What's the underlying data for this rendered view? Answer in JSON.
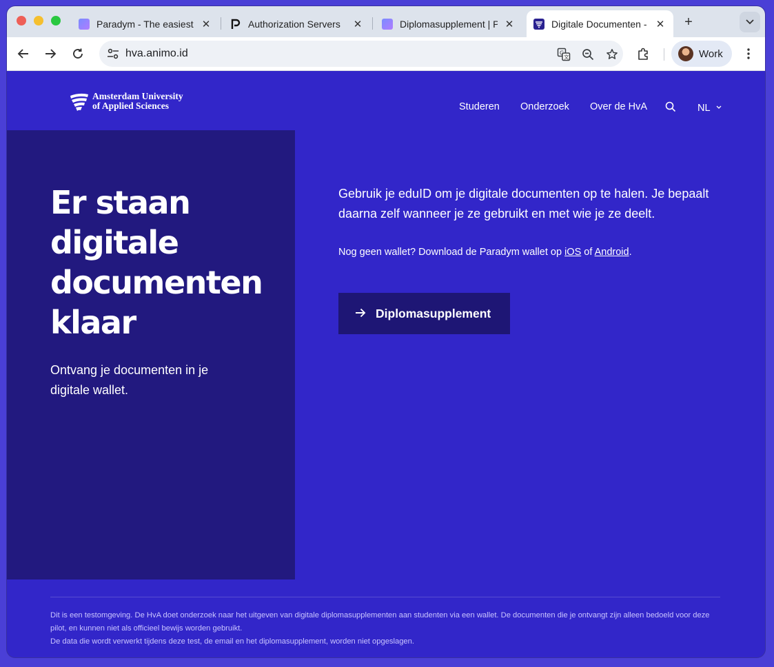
{
  "browser": {
    "tabs": [
      {
        "title": "Paradym - The easiest",
        "favicon": "paradym-gradient-icon",
        "active": false
      },
      {
        "title": "Authorization Servers",
        "favicon": "paradym-p-icon",
        "active": false
      },
      {
        "title": "Diplomasupplement | P",
        "favicon": "paradym-gradient-icon",
        "active": false
      },
      {
        "title": "Digitale Documenten -",
        "favicon": "hva-icon",
        "active": true
      }
    ],
    "url": "hva.animo.id",
    "profile_label": "Work"
  },
  "site": {
    "logo_line1": "Amsterdam University",
    "logo_line2": "of Applied Sciences",
    "nav": [
      "Studeren",
      "Onderzoek",
      "Over de HvA"
    ],
    "language": "NL"
  },
  "hero": {
    "title": "Er staan digitale documenten klaar",
    "subtitle": "Ontvang je documenten in je digitale wallet."
  },
  "main": {
    "intro": "Gebruik je eduID om je digitale documenten op te halen. Je bepaalt daarna zelf wanneer je ze gebruikt en met wie je ze deelt.",
    "wallet_prefix": "Nog geen wallet? Download de Paradym wallet op ",
    "wallet_ios": "iOS",
    "wallet_of": " of ",
    "wallet_android": "Android",
    "wallet_suffix": ".",
    "cta_label": "Diplomasupplement"
  },
  "footer": {
    "line1": "Dit is een testomgeving. De HvA doet onderzoek naar het uitgeven van digitale diplomasupplementen aan studenten via een wallet. De documenten die je ontvangt zijn alleen bedoeld voor deze pilot, en kunnen niet als officieel bewijs worden gebruikt.",
    "line2": "De data die wordt verwerkt tijdens deze test, de email en het diplomasupplement, worden niet opgeslagen."
  },
  "colors": {
    "page_bg": "#3226c9",
    "hero_panel": "#22197f",
    "cta_bg": "#1e1675"
  }
}
